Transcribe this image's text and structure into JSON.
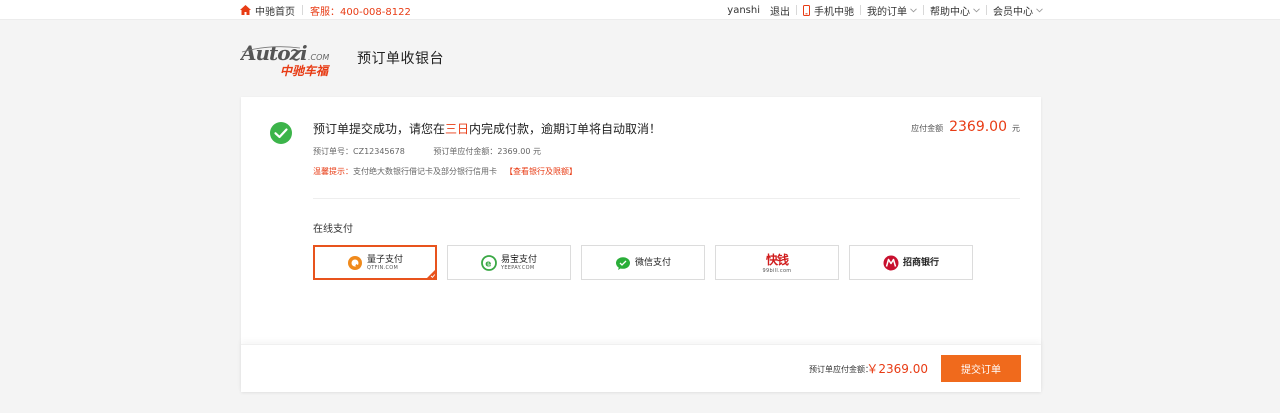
{
  "topbar": {
    "home_label": "中驰首页",
    "hotline": "客服：400-008-8122",
    "username": "yanshi",
    "logout": "退出",
    "mobile": "手机中驰",
    "my_orders": "我的订单",
    "help_center": "帮助中心",
    "member_center": "会员中心"
  },
  "header": {
    "logo_text": "Autozi.com",
    "logo_cn": "中驰车福",
    "page_title": "预订单收银台"
  },
  "order": {
    "headline_prefix": "预订单提交成功，请您在",
    "headline_highlight": "三日",
    "headline_suffix": "内完成付款，逾期订单将自动取消！",
    "order_no": "预订单号：CZ12345678",
    "order_amount": "预订单应付金额：2369.00 元",
    "tip_label": "温馨提示：",
    "tip_text": "支付绝大数银行借记卡及部分银行信用卡",
    "tip_link": "【查看银行及限额】",
    "due_label": "应付金额",
    "due_amount": "2369.00",
    "due_unit": "元"
  },
  "payment": {
    "section_title": "在线支付",
    "options": [
      {
        "name": "量子支付",
        "sub": "QTFIN.COM",
        "icon": "qtfin-logo-icon",
        "selected": true
      },
      {
        "name": "易宝支付",
        "sub": "YEEPAY.COM",
        "icon": "yeepay-logo-icon",
        "selected": false
      },
      {
        "name": "微信支付",
        "sub": "",
        "icon": "wechat-pay-icon",
        "selected": false
      },
      {
        "name": "快钱",
        "sub": "99bill.com",
        "icon": "kuaiqian-logo-icon",
        "selected": false
      },
      {
        "name": "招商银行",
        "sub": "",
        "icon": "cmb-logo-icon",
        "selected": false
      }
    ]
  },
  "footer": {
    "total_label": "预订单应付金额：",
    "total_amount": "￥2369.00",
    "submit_label": "提交订单"
  },
  "colors": {
    "accent": "#e83c15",
    "button": "#f06a1c",
    "success": "#3cb44a"
  }
}
